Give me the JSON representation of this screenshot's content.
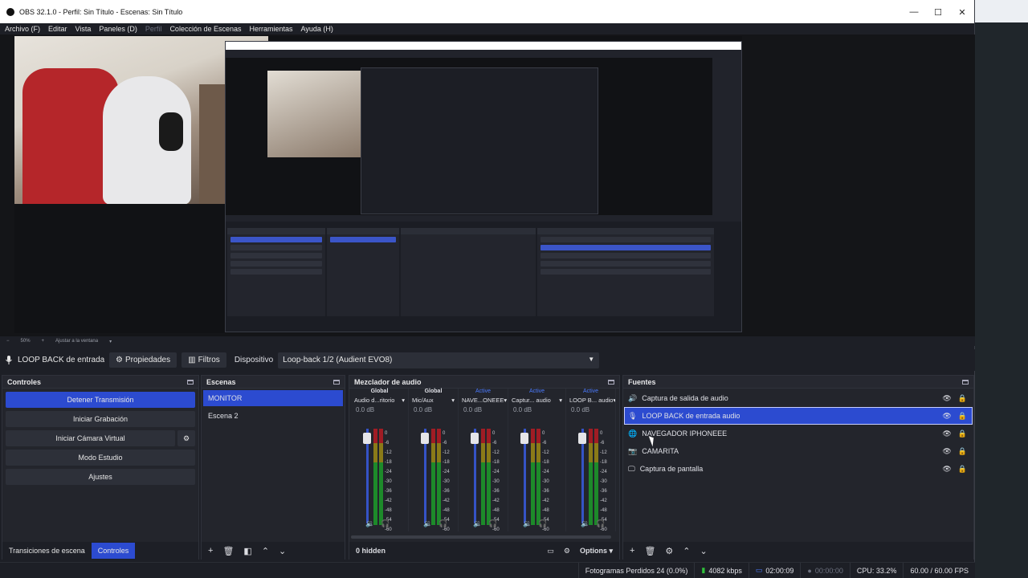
{
  "window": {
    "title": "OBS 32.1.0 - Perfil: Sin Título - Escenas: Sin Título",
    "minimize": "—",
    "maximize": "☐",
    "close": "✕"
  },
  "menu": {
    "items": [
      "Archivo (F)",
      "Editar",
      "Vista",
      "Paneles (D)",
      "Perfil",
      "Colección de Escenas",
      "Herramientas",
      "Ayuda (H)"
    ]
  },
  "zoom": {
    "minus": "−",
    "value": "50%",
    "plus": "+",
    "fit_label": "Ajustar a la ventana"
  },
  "source_toolbar": {
    "source_name": "LOOP BACK de entrada auc",
    "properties_label": "Propiedades",
    "filters_label": "Filtros",
    "device_label": "Dispositivo",
    "device_value": "Loop-back 1/2 (Audient EVO8)"
  },
  "controls": {
    "title": "Controles",
    "stop_stream": "Detener Transmisión",
    "start_recording": "Iniciar Grabación",
    "start_virtual_cam": "Iniciar Cámara Virtual",
    "studio_mode": "Modo Estudio",
    "settings": "Ajustes",
    "tab_transitions": "Transiciones de escena",
    "tab_controls": "Controles"
  },
  "scenes": {
    "title": "Escenas",
    "items": [
      "MONITOR",
      "Escena 2"
    ]
  },
  "mixer": {
    "title": "Mezclador de audio",
    "hidden_label": "0 hidden",
    "options_label": "Options",
    "scale": [
      "0",
      "-6",
      "-12",
      "-18",
      "-24",
      "-30",
      "-36",
      "-42",
      "-48",
      "-54",
      "-60"
    ],
    "channels": [
      {
        "status": "Global",
        "name": "Audio d...ritorio",
        "db": "0.0 dB"
      },
      {
        "status": "Global",
        "name": "Mic/Aux",
        "db": "0.0 dB"
      },
      {
        "status": "Active",
        "name": "NAVE...ONEEE",
        "db": "0.0 dB"
      },
      {
        "status": "Active",
        "name": "Captur... audio",
        "db": "0.0 dB"
      },
      {
        "status": "Active",
        "name": "LOOP B... audio",
        "db": "0.0 dB"
      }
    ]
  },
  "sources": {
    "title": "Fuentes",
    "items": [
      {
        "name": "Captura de salida de audio",
        "icon": "speaker-icon"
      },
      {
        "name": "LOOP BACK de entrada audio",
        "icon": "mic-icon"
      },
      {
        "name": "NAVEGADOR IPHONEEE",
        "icon": "globe-icon"
      },
      {
        "name": "CAMARITA",
        "icon": "camera-icon"
      },
      {
        "name": "Captura de pantalla",
        "icon": "monitor-icon"
      }
    ]
  },
  "status": {
    "dropped_frames": "Fotogramas Perdidos 24 (0.0%)",
    "bitrate": "4082 kbps",
    "stream_time": "02:00:09",
    "rec_time": "00:00:00",
    "cpu": "CPU: 33.2%",
    "fps": "60.00 / 60.00 FPS"
  },
  "colors": {
    "accent": "#2c4bd0",
    "meter_red": "#a01c24",
    "meter_yellow": "#8a7a18",
    "meter_green": "#1d8a2a"
  }
}
